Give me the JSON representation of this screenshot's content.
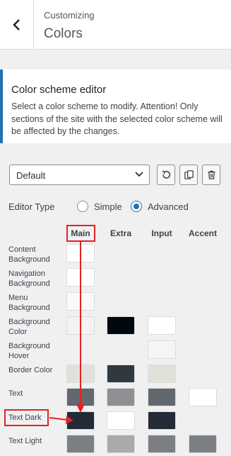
{
  "header": {
    "subtitle": "Customizing",
    "title": "Colors"
  },
  "info": {
    "title": "Color scheme editor",
    "text": "Select a color scheme to modify. Attention! Only sections of the site with the selected color scheme will be affected by the changes."
  },
  "scheme_select": {
    "value": "Default"
  },
  "toolbar": {
    "reset_icon": "reset-icon",
    "copy_icon": "copy-icon",
    "delete_icon": "trash-icon"
  },
  "editor_type": {
    "label": "Editor Type",
    "simple": "Simple",
    "advanced": "Advanced",
    "selected": "Advanced"
  },
  "columns": [
    "Main",
    "Extra",
    "Input",
    "Accent"
  ],
  "rows": [
    {
      "label": "Content Background",
      "colors": [
        "#ffffff",
        null,
        null,
        null
      ]
    },
    {
      "label": "Navigation Background",
      "colors": [
        "#ffffff",
        null,
        null,
        null
      ]
    },
    {
      "label": "Menu Background",
      "colors": [
        "#f9f9f9",
        null,
        null,
        null
      ]
    },
    {
      "label": "Background Color",
      "colors": [
        "#f3f3f1",
        "#020810",
        "#ffffff",
        null
      ]
    },
    {
      "label": "Background Hover",
      "colors": [
        null,
        null,
        "#f5f5f5",
        null
      ]
    },
    {
      "label": "Border Color",
      "colors": [
        "#e1e1dc",
        "#2f393f",
        "#e1e1d9",
        null
      ]
    },
    {
      "label": "Text",
      "colors": [
        "#62686e",
        "#8f9093",
        "#62686e",
        "#ffffff"
      ]
    },
    {
      "label": "Text Dark",
      "colors": [
        "#232b37",
        "#ffffff",
        "#232b37",
        null
      ]
    },
    {
      "label": "Text Light",
      "colors": [
        "#7c7f84",
        "#a8aaac",
        "#7c7f84",
        "#7c7f84"
      ]
    }
  ],
  "colors": {
    "accent": "#2271b1",
    "annotation": "#e02424"
  }
}
